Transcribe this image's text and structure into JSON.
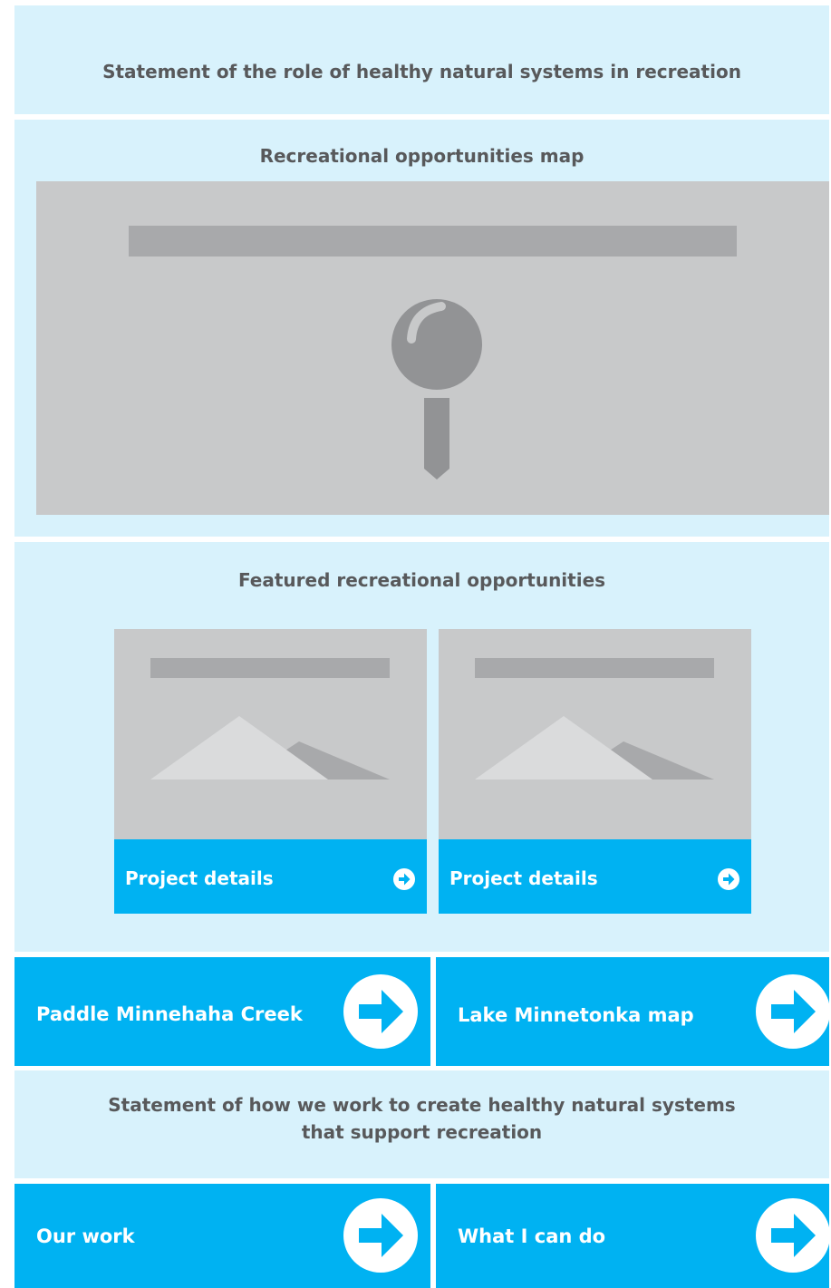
{
  "intro": {
    "statement": "Statement of the role of healthy natural systems in recreation"
  },
  "map_section": {
    "title": "Recreational opportunities map",
    "icon": "map-pin-icon"
  },
  "featured": {
    "title": "Featured recreational opportunities",
    "cards": [
      {
        "label": "Project details",
        "icon": "image-placeholder-icon"
      },
      {
        "label": "Project details",
        "icon": "image-placeholder-icon"
      }
    ]
  },
  "links_primary": [
    {
      "label": "Paddle Minnehaha Creek",
      "icon": "arrow-right-circle-icon"
    },
    {
      "label": "Lake Minnetonka map",
      "icon": "arrow-right-circle-icon"
    }
  ],
  "how_we_work": {
    "line1": "Statement of how we work to create healthy natural systems",
    "line2": "that support recreation"
  },
  "links_secondary": [
    {
      "label": "Our work",
      "icon": "arrow-right-circle-icon"
    },
    {
      "label": "What I can do",
      "icon": "arrow-right-circle-icon"
    }
  ],
  "colors": {
    "panel_bg": "#d8f2fc",
    "accent": "#00b2f2",
    "placeholder": "#c8c9ca",
    "placeholder_dark": "#a8a9ab",
    "text": "#58595b"
  }
}
